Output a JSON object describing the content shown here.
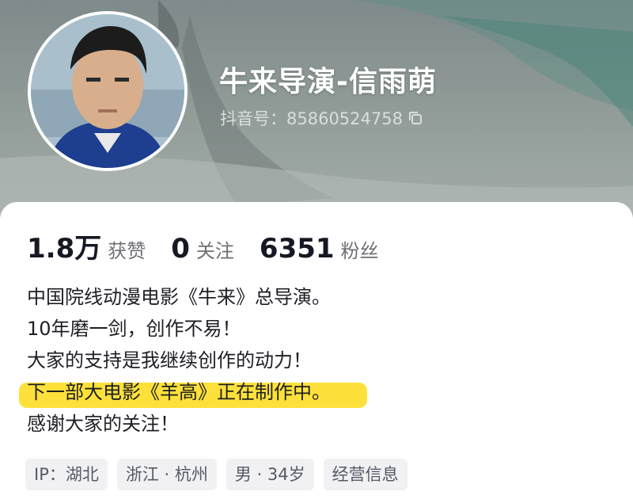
{
  "profile": {
    "name": "牛来导演-信雨萌",
    "id_label": "抖音号：85860524758",
    "avatar_icon": "avatar-photo"
  },
  "stats": [
    {
      "value": "1.8万",
      "label": "获赞"
    },
    {
      "value": "0",
      "label": "关注"
    },
    {
      "value": "6351",
      "label": "粉丝"
    }
  ],
  "bio": [
    "中国院线动漫电影《牛来》总导演。",
    "10年磨一剑，创作不易！",
    "大家的支持是我继续创作的动力！",
    "下一部大电影《羊高》正在制作中。",
    "感谢大家的关注！"
  ],
  "tags": [
    "IP：湖北",
    "浙江 · 杭州",
    "男 · 34岁",
    "经营信息"
  ],
  "colors": {
    "highlight": "#fde13a",
    "text": "#161823",
    "muted": "#6f7075",
    "tag_bg": "#f1f1f3"
  }
}
